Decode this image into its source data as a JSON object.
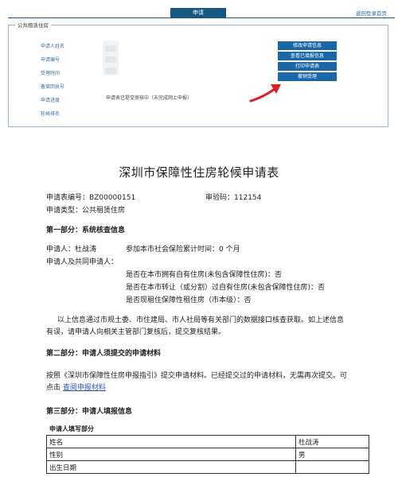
{
  "topbar": {
    "apply_tab": "申请",
    "top_right_link": "返回登录首页"
  },
  "panel": {
    "legend": "公共租赁住房",
    "fields": [
      "申请人姓名",
      "申请编号",
      "受理时间",
      "备案回执号",
      "申请进度",
      "轮候排名"
    ],
    "status_text": "申请表已提交审核中（未完成网上申报）",
    "buttons": [
      "修改申请信息",
      "查看已填报信息",
      "打印申请表",
      "撤销受理"
    ],
    "arrow_color": "#e02020"
  },
  "document": {
    "title": "深圳市保障性住房轮候申请表",
    "form_no_label": "申请表编号：",
    "form_no": "BZ00000151",
    "verify_label": "审验码：",
    "verify_code": "112154",
    "type_label": "申请类型：",
    "type_value": "公共租赁住房",
    "part1_heading": "第一部分：系统核查信息",
    "applicant": "申请人：杜战涛",
    "social_security": "参加本市社会保险累计时间：0 个月",
    "co_applicants": "申请人及共同申请人：",
    "check1": "是否在本市拥有自有住房(未包含保障性住房)：否",
    "check2": "是否在本市转让（或分割）过自有住房(未包含保障性住房)：否",
    "check3": "是否现租住保障性租住房（市本级）：否",
    "para1_line1": "以上信息通过市规土委、市住建局、市人社局等有关部门的数据接口核查获取。如上述信息",
    "para1_line2": "有误，请申请人向相关主管部门复核后，提交复核结果。",
    "part2_heading": "第二部分：申请人须提交的申请材料",
    "para2_line1": "按照《深圳市保障性住房申报指引》提交申请材料。已经提交过的申请材料，无需再次提交。可",
    "para2_prefix": "点击",
    "para2_link": "查阅申报材料",
    "part3_heading": "第三部分：申请人填报信息",
    "fill_section": "申请人填写部分",
    "table": [
      {
        "label": "姓名",
        "value": "杜战涛"
      },
      {
        "label": "性别",
        "value": "男"
      },
      {
        "label": "出生日期",
        "value": ""
      }
    ]
  }
}
